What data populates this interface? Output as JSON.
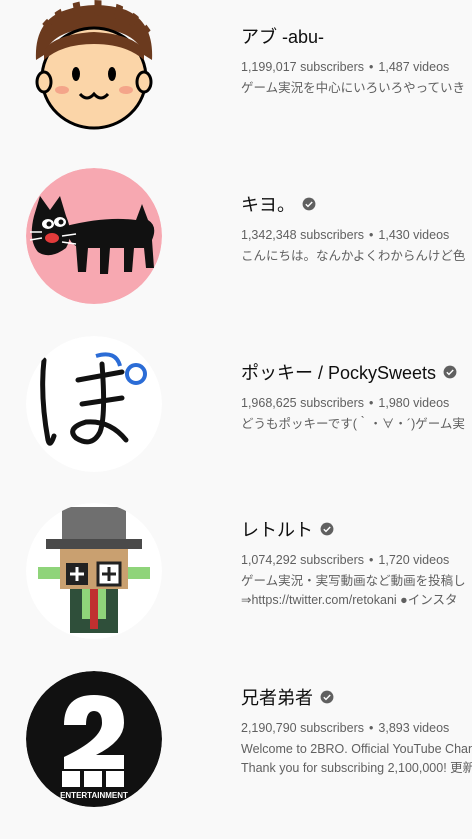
{
  "channels": [
    {
      "name": "アブ -abu-",
      "verified": false,
      "subscribers": "1,199,017 subscribers",
      "videos": "1,487 videos",
      "description": [
        "ゲーム実況を中心にいろいろやっていき"
      ]
    },
    {
      "name": "キヨ。",
      "verified": true,
      "subscribers": "1,342,348 subscribers",
      "videos": "1,430 videos",
      "description": [
        "こんにちは。なんかよくわからんけど色"
      ]
    },
    {
      "name": "ポッキー / PockySweets",
      "verified": true,
      "subscribers": "1,968,625 subscribers",
      "videos": "1,980 videos",
      "description": [
        "どうもポッキーです(｀・∀・´)ゲーム実"
      ]
    },
    {
      "name": "レトルト",
      "verified": true,
      "subscribers": "1,074,292 subscribers",
      "videos": "1,720 videos",
      "description": [
        "ゲーム実況・実写動画など動画を投稿し",
        "⇒https://twitter.com/retokani ●インスタ"
      ]
    },
    {
      "name": "兄者弟者",
      "verified": true,
      "subscribers": "2,190,790 subscribers",
      "videos": "3,893 videos",
      "description": [
        "Welcome to 2BRO. Official YouTube Chan",
        "Thank you for subscribing 2,100,000! 更新"
      ],
      "avatar_text": "ENTERTAINMENT"
    }
  ],
  "separator": "•",
  "colors": {
    "background": "#f9f9f9",
    "secondary_text": "#606060",
    "verified_badge": "#606060",
    "kiyo_avatar_bg": "#f7a8b1"
  }
}
